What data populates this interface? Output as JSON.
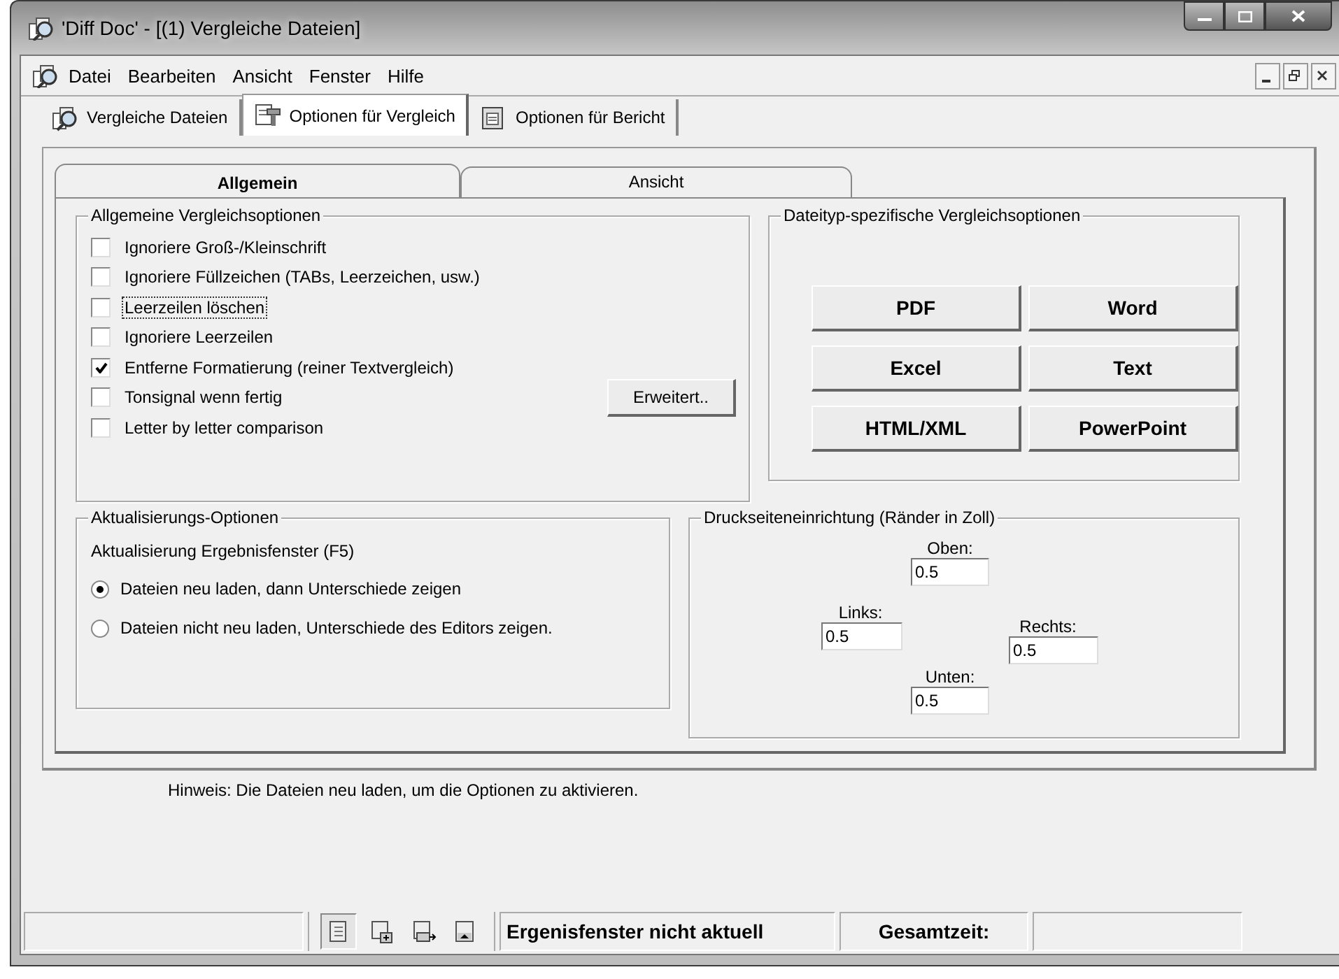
{
  "window": {
    "title": "'Diff Doc' - [(1) Vergleiche Dateien]"
  },
  "menu": [
    "Datei",
    "Bearbeiten",
    "Ansicht",
    "Fenster",
    "Hilfe"
  ],
  "main_tabs": [
    {
      "label": "Vergleiche Dateien",
      "selected": false
    },
    {
      "label": "Optionen für Vergleich",
      "selected": true
    },
    {
      "label": "Optionen für Bericht",
      "selected": false
    }
  ],
  "sub_tabs": [
    {
      "label": "Allgemein",
      "selected": true
    },
    {
      "label": "Ansicht",
      "selected": false
    }
  ],
  "compare_options": {
    "title": "Allgemeine Vergleichsoptionen",
    "options": [
      {
        "label": "Ignoriere Groß-/Kleinschrift",
        "checked": false,
        "focused": false
      },
      {
        "label": "Ignoriere Füllzeichen (TABs, Leerzeichen, usw.)",
        "checked": false,
        "focused": false
      },
      {
        "label": "Leerzeilen löschen",
        "checked": false,
        "focused": true
      },
      {
        "label": "Ignoriere Leerzeilen",
        "checked": false,
        "focused": false
      },
      {
        "label": "Entferne Formatierung (reiner Textvergleich)",
        "checked": true,
        "focused": false
      },
      {
        "label": "Tonsignal wenn fertig",
        "checked": false,
        "focused": false
      },
      {
        "label": "Letter by letter comparison",
        "checked": false,
        "focused": false
      }
    ],
    "advanced_button": "Erweitert.."
  },
  "filetype_options": {
    "title": "Dateityp-spezifische Vergleichsoptionen",
    "buttons": [
      "PDF",
      "Word",
      "Excel",
      "Text",
      "HTML/XML",
      "PowerPoint"
    ]
  },
  "update_options": {
    "title": "Aktualisierungs-Optionen",
    "caption": "Aktualisierung Ergebnisfenster (F5)",
    "radios": [
      {
        "label": "Dateien neu laden, dann Unterschiede zeigen",
        "selected": true
      },
      {
        "label": "Dateien nicht neu laden, Unterschiede des Editors zeigen.",
        "selected": false
      }
    ]
  },
  "print_setup": {
    "title": "Druckseiteneinrichtung (Ränder in Zoll)",
    "fields": [
      {
        "label": "Oben:",
        "value": "0.5"
      },
      {
        "label": "Links:",
        "value": "0.5"
      },
      {
        "label": "Rechts:",
        "value": "0.5"
      },
      {
        "label": "Unten:",
        "value": "0.5"
      }
    ]
  },
  "hint": "Hinweis: Die Dateien neu laden, um die  Optionen zu aktivieren.",
  "status_bar": {
    "tools": [
      {
        "selected": true
      },
      {
        "selected": false
      },
      {
        "selected": false
      },
      {
        "selected": false
      }
    ],
    "message": "Ergenisfenster nicht aktuell",
    "total_label": "Gesamtzeit:"
  }
}
